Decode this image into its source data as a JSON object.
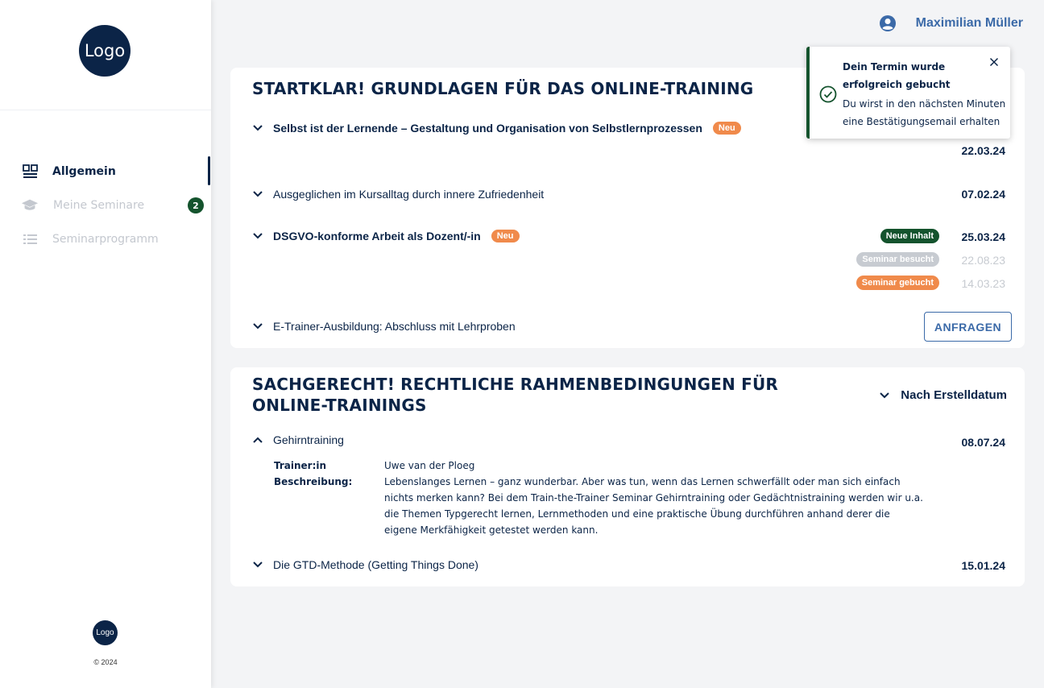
{
  "sidebar": {
    "logo_text": "Logo",
    "nav": [
      {
        "label": "Allgemein",
        "icon": "dashboard-icon",
        "active": true
      },
      {
        "label": "Meine Seminare",
        "icon": "graduation-cap-icon",
        "badge": "2"
      },
      {
        "label": "Seminarprogramm",
        "icon": "list-icon"
      }
    ],
    "footer_logo_text": "Logo",
    "copyright": "© 2024"
  },
  "header": {
    "user_icon": "user-circle-icon",
    "user_name": "Maximilian Müller"
  },
  "sections": [
    {
      "title": "STARTKLAR! GRUNDLAGEN FÜR DAS ONLINE-TRAINING",
      "items": [
        {
          "title": "Selbst ist der Lernende – Gestaltung und Organisation von Selbstlernprozessen",
          "badge": "Neu",
          "date": "22.03.24"
        },
        {
          "title": "Ausgeglichen im Kursalltag durch innere Zufriedenheit",
          "date": "07.02.24"
        },
        {
          "title": "DSGVO-konforme Arbeit als Dozent/-in",
          "badge": "Neu",
          "statuses": [
            {
              "label": "Neue Inhalt",
              "date": "25.03.24",
              "color": "#14532d"
            },
            {
              "label": "Seminar  besucht",
              "date": "22.08.23",
              "color": "#c7cbd1"
            },
            {
              "label": "Seminar gebucht",
              "date": "14.03.23",
              "color": "#f08a4b"
            }
          ]
        },
        {
          "title": "E-Trainer-Ausbildung: Abschluss mit Lehrproben",
          "action_label": "ANFRAGEN"
        }
      ]
    },
    {
      "title": "SACHGERECHT! RECHTLICHE RAHMENBEDINGUNGEN FÜR ONLINE-TRAININGS",
      "sort_label": "Nach Erstelldatum",
      "items": [
        {
          "title": "Gehirntraining",
          "date": "08.07.24",
          "expanded": true,
          "trainer_label": "Trainer:in",
          "trainer": "Uwe van der Ploeg",
          "description_label": "Beschreibung:",
          "description": "Lebenslanges Lernen – ganz wunderbar. Aber was tun, wenn das Lernen schwerfällt oder man sich einfach nichts merken kann? Bei dem Train-the-Trainer Seminar Gehirntraining oder Gedächtnistraining werden wir u.a. die Themen Typgerecht lernen, Lernmethoden und eine praktische Übung durchführen anhand derer die eigene Merkfähigkeit getestet werden kann."
        },
        {
          "title": "Die GTD-Methode (Getting Things Done)",
          "date": "15.01.24"
        }
      ]
    }
  ],
  "toast": {
    "icon": "check-circle-icon",
    "title": "Dein Termin wurde erfolgreich gebucht",
    "message": "Du wirst in den nächsten Minuten eine Bestätigungsemail erhalten",
    "close_icon": "close-icon",
    "accent": "#14532d"
  },
  "colors": {
    "navy": "#0b2447",
    "link": "#3b6aa8",
    "orange": "#f08a4b",
    "green": "#14532d",
    "muted": "#c7cbd1"
  }
}
